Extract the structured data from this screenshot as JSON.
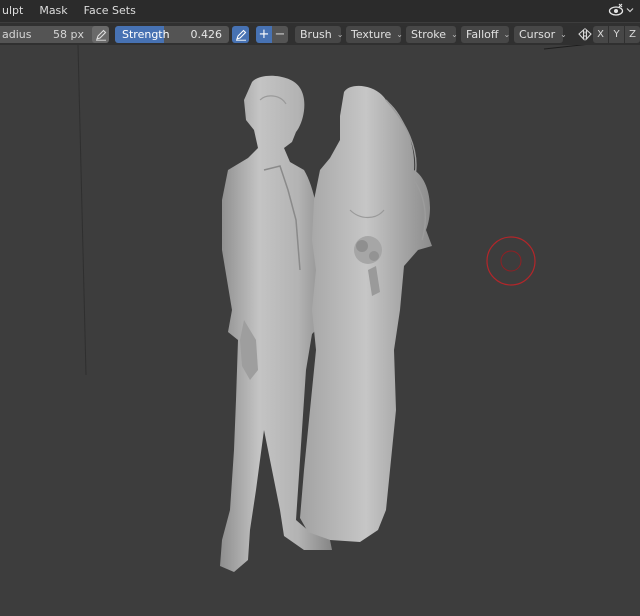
{
  "menubar": {
    "items": [
      {
        "label": "ulpt"
      },
      {
        "label": "Mask"
      },
      {
        "label": "Face Sets"
      }
    ],
    "right_icons": [
      "view-eye-icon",
      "chevron-down-icon"
    ]
  },
  "toolbar": {
    "radius": {
      "label": "adius",
      "value": "58 px"
    },
    "strength": {
      "label": "Strength",
      "value": "0.426",
      "fill": 0.426
    },
    "direction": {
      "add": "+",
      "subtract": "−"
    },
    "dropdowns": {
      "brush": "Brush",
      "texture": "Texture",
      "stroke": "Stroke",
      "falloff": "Falloff",
      "cursor": "Cursor"
    },
    "symmetry_axes": {
      "x": "X",
      "y": "Y",
      "z": "Z"
    }
  },
  "colors": {
    "accent": "#4772b3",
    "viewport_bg": "#3d3d3d",
    "brush_cursor": "#b3262a",
    "mesh": "#b9b9b9"
  }
}
